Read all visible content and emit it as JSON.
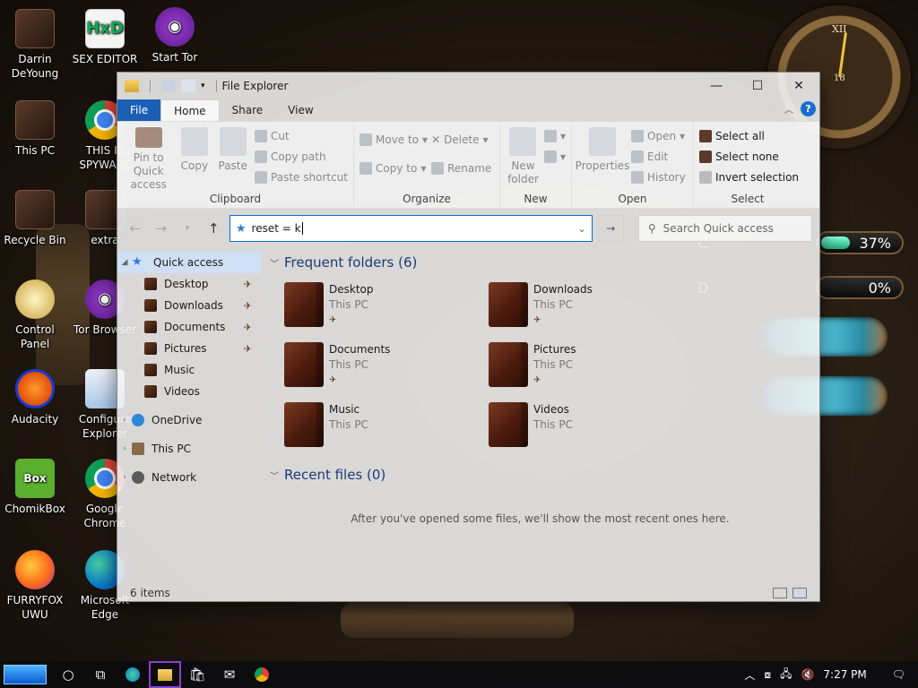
{
  "desktop": {
    "icons": [
      {
        "label": "Darrin DeYoung"
      },
      {
        "label": "SEX EDITOR"
      },
      {
        "label": "Start Tor"
      },
      {
        "label": "This PC"
      },
      {
        "label": "THIS IS SPYWARE"
      },
      {
        "label": "Recycle Bin"
      },
      {
        "label": "extra"
      },
      {
        "label": "Control Panel"
      },
      {
        "label": "Tor Browser"
      },
      {
        "label": "Audacity"
      },
      {
        "label": "Configure Explorer"
      },
      {
        "label": "ChomikBox"
      },
      {
        "label": "Google Chrome"
      },
      {
        "label": "FURRYFOX UWU"
      },
      {
        "label": "Microsoft Edge"
      }
    ],
    "gauges": [
      {
        "letter": "C",
        "percent": "37%",
        "fill": 0.37
      },
      {
        "letter": "D",
        "percent": "0%",
        "fill": 0.0
      }
    ],
    "clock_numerals": {
      "xii": "XII",
      "center": "18"
    }
  },
  "window": {
    "title": "File Explorer",
    "controls": {
      "minimize": "—",
      "maximize": "☐",
      "close": "✕"
    },
    "tabs": [
      "File",
      "Home",
      "Share",
      "View"
    ],
    "active_tab": "Home",
    "help": "?",
    "ribbon": {
      "clipboard": {
        "label": "Clipboard",
        "pin": "Pin to Quick access",
        "copy": "Copy",
        "paste": "Paste",
        "cut": "Cut",
        "copy_path": "Copy path",
        "paste_shortcut": "Paste shortcut"
      },
      "organize": {
        "label": "Organize",
        "move_to": "Move to",
        "copy_to": "Copy to",
        "delete": "Delete",
        "rename": "Rename"
      },
      "new": {
        "label": "New",
        "new_folder": "New folder"
      },
      "open": {
        "label": "Open",
        "properties": "Properties",
        "open": "Open",
        "edit": "Edit",
        "history": "History"
      },
      "select": {
        "label": "Select",
        "select_all": "Select all",
        "select_none": "Select none",
        "invert": "Invert selection"
      }
    },
    "address": {
      "value": "reset = k"
    },
    "search": {
      "placeholder": "Search Quick access"
    },
    "nav": [
      {
        "label": "Quick access",
        "type": "star"
      },
      {
        "label": "Desktop",
        "type": "folder"
      },
      {
        "label": "Downloads",
        "type": "folder"
      },
      {
        "label": "Documents",
        "type": "folder"
      },
      {
        "label": "Pictures",
        "type": "folder"
      },
      {
        "label": "Music",
        "type": "folder"
      },
      {
        "label": "Videos",
        "type": "folder"
      },
      {
        "label": "OneDrive",
        "type": "cloud"
      },
      {
        "label": "This PC",
        "type": "pc"
      },
      {
        "label": "Network",
        "type": "net"
      }
    ],
    "frequent": {
      "heading": "Frequent folders (6)",
      "items": [
        {
          "name": "Desktop",
          "location": "This PC"
        },
        {
          "name": "Downloads",
          "location": "This PC"
        },
        {
          "name": "Documents",
          "location": "This PC"
        },
        {
          "name": "Pictures",
          "location": "This PC"
        },
        {
          "name": "Music",
          "location": "This PC"
        },
        {
          "name": "Videos",
          "location": "This PC"
        }
      ]
    },
    "recent": {
      "heading": "Recent files (0)",
      "empty_message": "After you've opened some files, we'll show the most recent ones here."
    },
    "status": {
      "items": "6 items"
    }
  },
  "taskbar": {
    "time": "7:27 PM"
  }
}
